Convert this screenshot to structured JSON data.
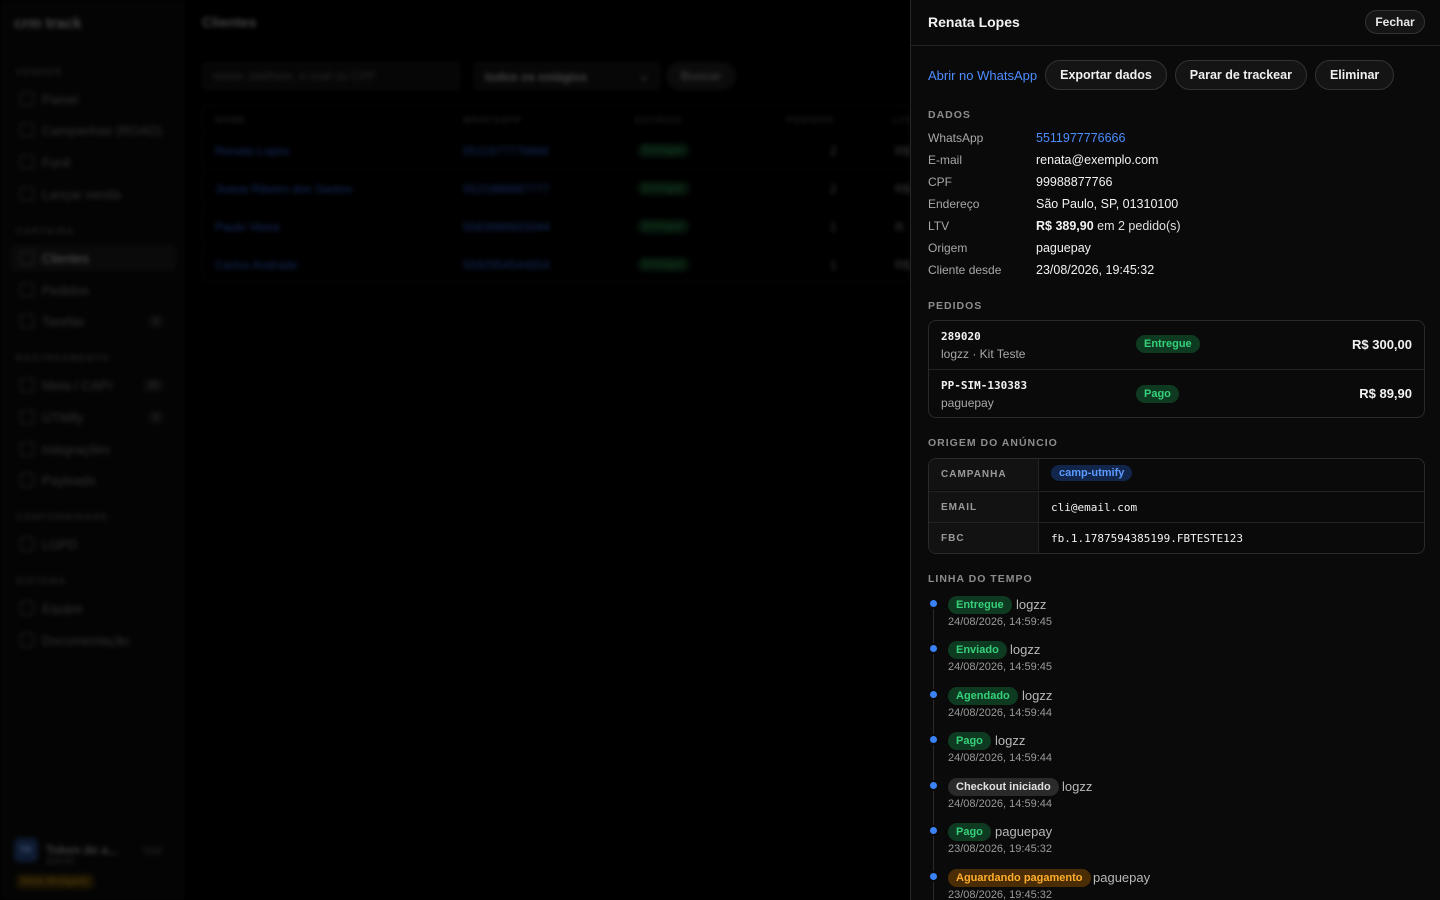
{
  "background": {
    "brand": "crm track",
    "sections": [
      {
        "title": "VENDER",
        "items": [
          {
            "label": "Painel"
          },
          {
            "label": "Campanhas (ROAD)"
          },
          {
            "label": "Funil"
          },
          {
            "label": "Lançar venda"
          }
        ]
      },
      {
        "title": "CARTEIRA",
        "items": [
          {
            "label": "Clientes"
          },
          {
            "label": "Pedidos"
          },
          {
            "label": "Tarefas",
            "badge": "0"
          }
        ]
      },
      {
        "title": "RASTREAMENTO",
        "items": [
          {
            "label": "Meta / CAPI",
            "badge": "30"
          },
          {
            "label": "UTMify",
            "badge": "0"
          },
          {
            "label": "Integrações"
          },
          {
            "label": "Payloads"
          }
        ]
      },
      {
        "title": "CONFORMIDADE",
        "items": [
          {
            "label": "LGPD"
          }
        ]
      },
      {
        "title": "SISTEMA",
        "items": [
          {
            "label": "Equipe"
          },
          {
            "label": "Documentação"
          }
        ]
      }
    ],
    "user": {
      "initials": "TK",
      "name": "Token de a...",
      "role": "Admin",
      "logout": "Sair",
      "meta_status": "Meta desligado"
    },
    "page_title": "Clientes",
    "search_placeholder": "nome, telefone, e-mail ou CPF",
    "stage_select": "todos os estágios",
    "search_button": "Buscar",
    "table": {
      "headers": [
        "NOME",
        "WHATSAPP",
        "ESTÁGIO",
        "PEDIDOS",
        "LTV"
      ],
      "rows": [
        {
          "name": "Renata Lopes",
          "whatsapp": "5511977776666",
          "stage": "Entregue",
          "orders": "2",
          "ltv": "R$"
        },
        {
          "name": "Joana Ribeiro dos Santos",
          "whatsapp": "5521988887777",
          "stage": "Entregue",
          "orders": "2",
          "ltv": "R$"
        },
        {
          "name": "Paulo Vieira",
          "whatsapp": "5583999933344",
          "stage": "Entregue",
          "orders": "1",
          "ltv": "R"
        },
        {
          "name": "Carlos Andrade",
          "whatsapp": "5592954544554",
          "stage": "Entregue",
          "orders": "1",
          "ltv": "R$"
        }
      ]
    }
  },
  "drawer": {
    "title": "Renata Lopes",
    "close_label": "Fechar",
    "actions": {
      "whatsapp": "Abrir no WhatsApp",
      "export": "Exportar dados",
      "stop_tracking": "Parar de trackear",
      "delete": "Eliminar"
    },
    "data_section": {
      "title": "DADOS",
      "whatsapp_label": "WhatsApp",
      "whatsapp_value": "5511977776666",
      "email_label": "E-mail",
      "email_value": "renata@exemplo.com",
      "cpf_label": "CPF",
      "cpf_value": "99988877766",
      "address_label": "Endereço",
      "address_value": "São Paulo, SP, 01310100",
      "ltv_label": "LTV",
      "ltv_amount": "R$ 389,90",
      "ltv_suffix": "em 2 pedido(s)",
      "origin_label": "Origem",
      "origin_value": "paguepay",
      "since_label": "Cliente desde",
      "since_value": "23/08/2026, 19:45:32"
    },
    "orders_section": {
      "title": "PEDIDOS",
      "orders": [
        {
          "id": "289020",
          "sub": "logzz · Kit Teste",
          "status": "Entregue",
          "value": "R$ 300,00"
        },
        {
          "id": "PP-SIM-130383",
          "sub": "paguepay",
          "status": "Pago",
          "value": "R$ 89,90"
        }
      ]
    },
    "ad_origin_section": {
      "title": "ORIGEM DO ANÚNCIO",
      "campaign_label": "CAMPANHA",
      "campaign_value": "camp-utmify",
      "email_label": "EMAIL",
      "email_value": "cli@email.com",
      "fbc_label": "FBC",
      "fbc_value": "fb.1.1787594385199.FBTESTE123"
    },
    "timeline_section": {
      "title": "LINHA DO TEMPO",
      "events": [
        {
          "status": "Entregue",
          "source": "logzz",
          "time": "24/08/2026, 14:59:45"
        },
        {
          "status": "Enviado",
          "source": "logzz",
          "time": "24/08/2026, 14:59:45"
        },
        {
          "status": "Agendado",
          "source": "logzz",
          "time": "24/08/2026, 14:59:44"
        },
        {
          "status": "Pago",
          "source": "logzz",
          "time": "24/08/2026, 14:59:44"
        },
        {
          "status": "Checkout iniciado",
          "source": "logzz",
          "time": "24/08/2026, 14:59:44"
        },
        {
          "status": "Pago",
          "source": "paguepay",
          "time": "23/08/2026, 19:45:32"
        },
        {
          "status": "Aguardando pagamento",
          "source": "paguepay",
          "time": "23/08/2026, 19:45:32"
        }
      ]
    }
  },
  "colors": {
    "accent": "#4c8dff",
    "success": "#35d17a",
    "warning": "#ffae2a",
    "background": "#0a0a0a"
  }
}
